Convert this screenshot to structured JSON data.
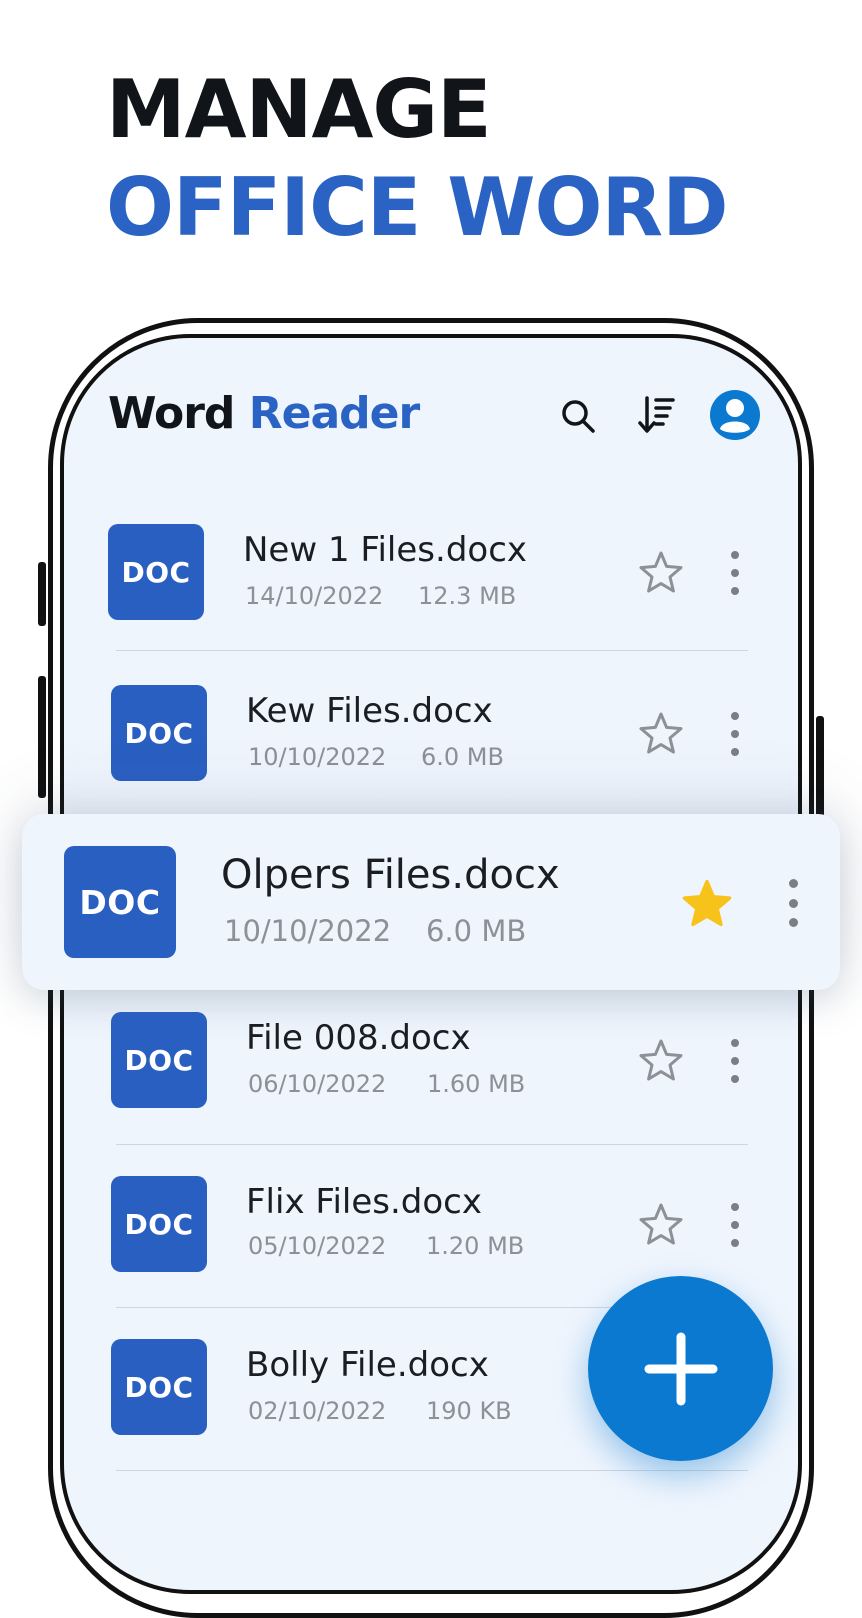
{
  "hero": {
    "line1": "MANAGE",
    "line2": "OFFICE WORD"
  },
  "appbar": {
    "title_part1": "Word",
    "title_part2": "Reader",
    "icons": [
      "search-icon",
      "sort-icon",
      "account-icon"
    ]
  },
  "badge_label": "DOC",
  "files": [
    {
      "name": "New 1 Files.docx",
      "date": "14/10/2022",
      "size": "12.3 MB",
      "starred": false
    },
    {
      "name": "Kew Files.docx",
      "date": "10/10/2022",
      "size": "6.0 MB",
      "starred": false
    },
    {
      "name": "Olpers Files.docx",
      "date": "10/10/2022",
      "size": "6.0 MB",
      "starred": true
    },
    {
      "name": "File 008.docx",
      "date": "06/10/2022",
      "size": "1.60 MB",
      "starred": false
    },
    {
      "name": "Flix Files.docx",
      "date": "05/10/2022",
      "size": "1.20 MB",
      "starred": false
    },
    {
      "name": "Bolly File.docx",
      "date": "02/10/2022",
      "size": "190 KB",
      "starred": false
    }
  ],
  "colors": {
    "accent": "#2a63c4",
    "doc_badge": "#2a5fc2",
    "fab": "#0a79cf",
    "star_active": "#f7c21a",
    "screen_bg": "#eff5fd"
  },
  "fab_icon": "plus-icon"
}
